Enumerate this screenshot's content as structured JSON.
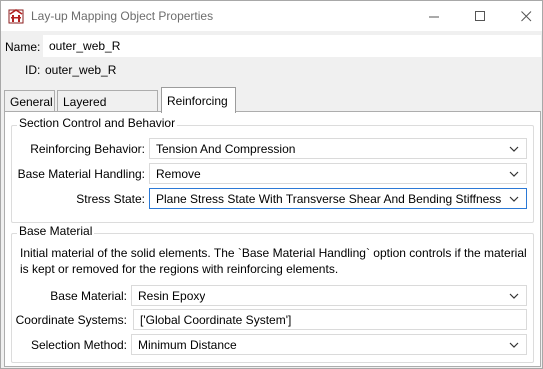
{
  "window": {
    "title": "Lay-up Mapping Object Properties",
    "minimize_glyph": "—",
    "maximize_glyph": "☐",
    "close_glyph": "✕"
  },
  "name": {
    "label": "Name:",
    "value": "outer_web_R"
  },
  "id": {
    "label": "ID:",
    "value": "outer_web_R"
  },
  "tabs": [
    {
      "label": "General",
      "active": false
    },
    {
      "label": "Layered Element",
      "active": false
    },
    {
      "label": "Reinforcing",
      "active": true
    }
  ],
  "section_control": {
    "title": "Section Control and Behavior",
    "reinforcing_behavior": {
      "label": "Reinforcing Behavior:",
      "value": "Tension And Compression"
    },
    "base_material_handling": {
      "label": "Base Material Handling:",
      "value": "Remove"
    },
    "stress_state": {
      "label": "Stress State:",
      "value": "Plane Stress State With Transverse Shear And Bending Stiffness"
    }
  },
  "base_material": {
    "title": "Base Material",
    "description": "Initial material of the solid elements. The `Base Material Handling` option controls if the material is kept or removed for the regions with reinforcing elements.",
    "material": {
      "label": "Base Material:",
      "value": "Resin Epoxy"
    },
    "coordinate_systems": {
      "label": "Coordinate Systems:",
      "value": "['Global Coordinate System']"
    },
    "selection_method": {
      "label": "Selection Method:",
      "value": "Minimum Distance"
    }
  },
  "colors": {
    "accent": "#2b79d6",
    "icon_red": "#c0392b"
  }
}
